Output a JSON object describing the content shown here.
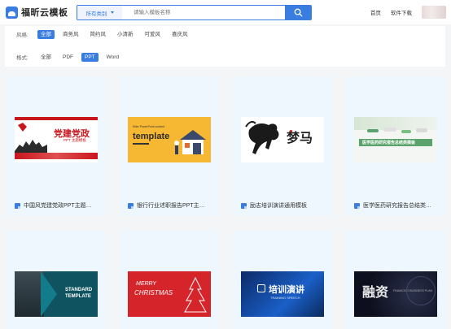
{
  "header": {
    "logo_text": "福昕云模板",
    "category_label": "所有类别",
    "search_placeholder": "请输入模板名称",
    "nav": [
      "首页",
      "软件下载"
    ]
  },
  "filters": {
    "style": {
      "label": "风格:",
      "options": [
        "全部",
        "商务风",
        "简约风",
        "小清新",
        "可爱风",
        "喜庆风"
      ],
      "selected": "全部"
    },
    "format": {
      "label": "格式:",
      "options": [
        "全部",
        "PDF",
        "PPT",
        "Word"
      ],
      "selected": "PPT"
    }
  },
  "cards": [
    {
      "title": "中国风党建党政PPT主题…",
      "thumb_text": [
        "党建党政",
        "PPT 主题模板"
      ],
      "icon": "ppt-file-icon"
    },
    {
      "title": "银行行业述职报告PPT主…",
      "thumb_text": [
        "Killer PowerPoint content",
        "template"
      ],
      "icon": "ppt-file-icon"
    },
    {
      "title": "励志培训演讲通用模板",
      "thumb_text": [
        "梦马"
      ],
      "icon": "ppt-file-icon"
    },
    {
      "title": "医学医药研究报告总结类…",
      "thumb_text": [
        "医学医药研究报告总结类模板"
      ],
      "icon": "ppt-file-icon"
    },
    {
      "title": "",
      "thumb_text": [
        "STANDARD",
        "TEMPLATE"
      ],
      "icon": "ppt-file-icon"
    },
    {
      "title": "",
      "thumb_text": [
        "MERRY",
        "CHRISTMAS"
      ],
      "icon": "ppt-file-icon"
    },
    {
      "title": "",
      "thumb_text": [
        "培训演讲",
        "TRAINING SPEECH"
      ],
      "icon": "ppt-file-icon"
    },
    {
      "title": "",
      "thumb_text": [
        "融资",
        "FINANCING BUSINESS PLAN"
      ],
      "icon": "ppt-file-icon"
    }
  ],
  "colors": {
    "accent": "#3a7de0",
    "card_bg": "#eef7fd"
  }
}
